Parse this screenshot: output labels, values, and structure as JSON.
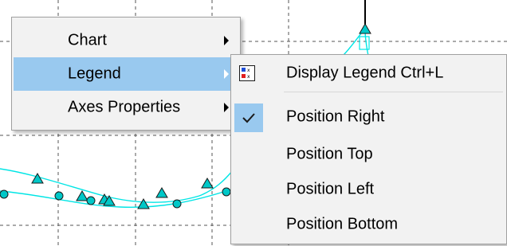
{
  "context_menu": {
    "items": [
      {
        "label": "Chart",
        "has_submenu": true,
        "highlighted": false
      },
      {
        "label": "Legend",
        "has_submenu": true,
        "highlighted": true
      },
      {
        "label": "Axes Properties",
        "has_submenu": true,
        "highlighted": false
      }
    ]
  },
  "legend_submenu": {
    "display_legend": {
      "label": "Display Legend Ctrl+L",
      "icon": "legend-icon"
    },
    "positions": [
      {
        "label": "Position Right",
        "checked": true
      },
      {
        "label": "Position Top",
        "checked": false
      },
      {
        "label": "Position Left",
        "checked": false
      },
      {
        "label": "Position Bottom",
        "checked": false
      }
    ]
  },
  "colors": {
    "menu_background": "#f2f2f2",
    "highlight": "#99c9ef",
    "series_line": "#00e5e5",
    "marker_fill": "#00c8c8"
  }
}
